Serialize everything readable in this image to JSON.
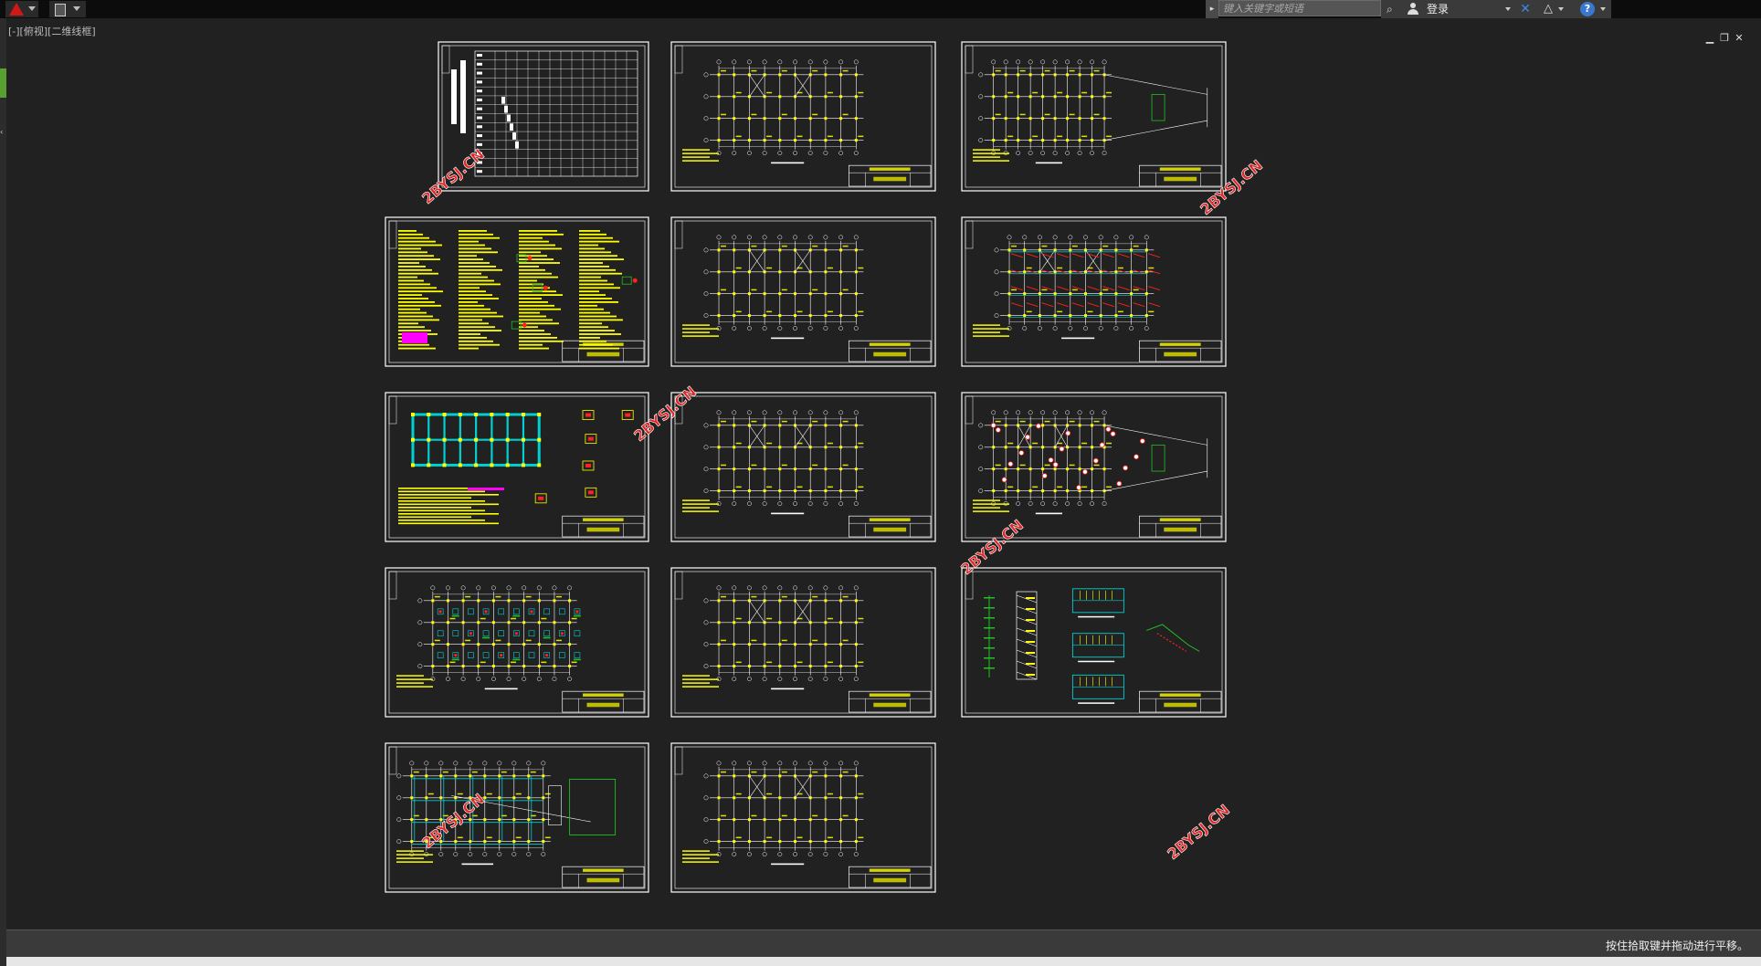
{
  "app": {
    "logo_icon": "autocad-logo-icon",
    "qat_icon": "document-icon"
  },
  "viewport": {
    "label": "[-][俯视][二维线框]"
  },
  "search": {
    "placeholder": "键入关键字或短语"
  },
  "account": {
    "login_label": "登录"
  },
  "toolbar_icons": [
    "binoculars-icon",
    "user-icon",
    "exchange-x-icon",
    "a360-icon",
    "help-icon"
  ],
  "window_controls": {
    "minimize": "▁",
    "restore": "❐",
    "close": "✕"
  },
  "watermark": {
    "text": "2BYSJ.CN",
    "color": "#e02828"
  },
  "status": {
    "message": "按住拾取键并拖动进行平移。"
  },
  "drawing_sheets": [
    {
      "id": "sheet-1",
      "content": "drawing-index-table"
    },
    {
      "id": "sheet-2",
      "content": "column-grid-plan"
    },
    {
      "id": "sheet-3",
      "content": "tapered-grid-plan"
    },
    {
      "id": "sheet-4",
      "content": "design-notes-text"
    },
    {
      "id": "sheet-5",
      "content": "column-grid-plan"
    },
    {
      "id": "sheet-6",
      "content": "reinforcement-plan-red"
    },
    {
      "id": "sheet-7",
      "content": "foundation-plan-cyan"
    },
    {
      "id": "sheet-8",
      "content": "column-grid-plan"
    },
    {
      "id": "sheet-9",
      "content": "tapered-grid-plan-red"
    },
    {
      "id": "sheet-10",
      "content": "beam-plan-colored"
    },
    {
      "id": "sheet-11",
      "content": "column-grid-plan"
    },
    {
      "id": "sheet-12",
      "content": "stair-details"
    },
    {
      "id": "sheet-13",
      "content": "foundation-extension-plan"
    },
    {
      "id": "sheet-14",
      "content": "column-grid-plan"
    }
  ],
  "colors": {
    "canvas": "#212121",
    "sheet_border": "#ffffff",
    "grid_line": "#ffffff",
    "annotation": "#ffff00",
    "cyan": "#00d0d0",
    "red": "#ff2020",
    "magenta": "#ff00ff",
    "green": "#20c020"
  }
}
